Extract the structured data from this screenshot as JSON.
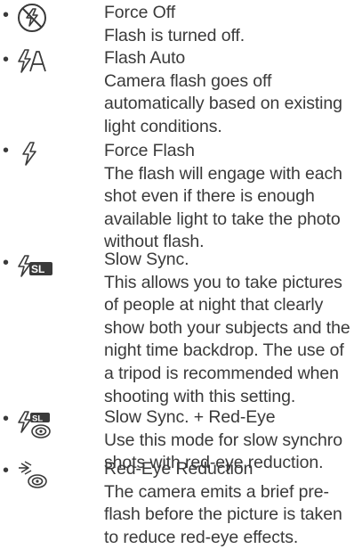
{
  "items": [
    {
      "icon": "flash-off-icon",
      "title": "Force Off",
      "desc_lines": [
        "Flash is turned off."
      ]
    },
    {
      "icon": "flash-auto-icon",
      "title": "Flash Auto",
      "desc_lines": [
        "Camera flash goes off",
        "automatically based on existing",
        "light conditions."
      ]
    },
    {
      "icon": "force-flash-icon",
      "title": "Force Flash",
      "desc_lines": [
        "The flash will engage with each",
        "shot even if there is enough",
        "available light to take the photo",
        "without flash."
      ]
    },
    {
      "icon": "slow-sync-icon",
      "title": "Slow Sync.",
      "desc_lines": [
        "This allows you to take pictures",
        "of people at night that clearly",
        "show both your subjects and the",
        "night time backdrop. The use of",
        "a tripod is recommended when",
        "shooting with this setting."
      ]
    },
    {
      "icon": "slow-sync-red-eye-icon",
      "title": "Slow Sync. + Red-Eye",
      "desc_lines": [
        "Use this mode for slow synchro",
        "shots with red-eye reduction."
      ]
    },
    {
      "icon": "red-eye-reduction-icon",
      "title": "Red-Eye Reduction",
      "desc_lines": [
        "The camera emits a brief pre-",
        "flash before the picture is taken",
        "to reduce red-eye effects."
      ]
    }
  ]
}
